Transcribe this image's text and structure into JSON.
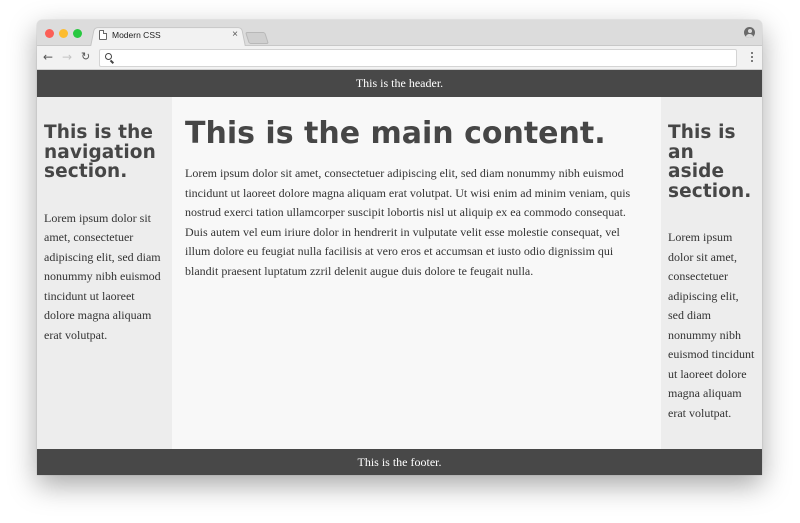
{
  "browser": {
    "tab_title": "Modern CSS",
    "tab_close_glyph": "×",
    "back_glyph": "←",
    "forward_glyph": "→",
    "reload_glyph": "↻",
    "address_value": "",
    "icons": [
      "close-window",
      "minimize-window",
      "maximize-window",
      "document-icon",
      "close-tab-icon",
      "new-tab",
      "back-arrow-icon",
      "forward-arrow-icon",
      "reload-icon",
      "search-icon",
      "profile-icon",
      "menu-kebab-icon"
    ]
  },
  "page": {
    "header_text": "This is the header.",
    "footer_text": "This is the footer.",
    "nav": {
      "heading": "This is the navigation section.",
      "text": "Lorem ipsum dolor sit amet, consectetuer adipiscing elit, sed diam nonummy nibh euismod tincidunt ut laoreet dolore magna aliquam erat volutpat."
    },
    "main": {
      "heading": "This is the main content.",
      "text": "Lorem ipsum dolor sit amet, consectetuer adipiscing elit, sed diam nonummy nibh euismod tincidunt ut laoreet dolore magna aliquam erat volutpat. Ut wisi enim ad minim veniam, quis nostrud exerci tation ullamcorper suscipit lobortis nisl ut aliquip ex ea commodo consequat. Duis autem vel eum iriure dolor in hendrerit in vulputate velit esse molestie consequat, vel illum dolore eu feugiat nulla facilisis at vero eros et accumsan et iusto odio dignissim qui blandit praesent luptatum zzril delenit augue duis dolore te feugait nulla."
    },
    "aside": {
      "heading": "This is an aside section.",
      "text": "Lorem ipsum dolor sit amet, consectetuer adipiscing elit, sed diam nonummy nibh euismod tincidunt ut laoreet dolore magna aliquam erat volutpat."
    }
  },
  "colors": {
    "header_footer_bg": "#484848",
    "side_bg": "#ededed",
    "main_bg": "#f8f8f8",
    "heading_text": "#464646"
  }
}
